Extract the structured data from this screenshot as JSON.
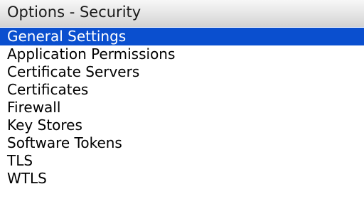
{
  "header": {
    "title": "Options - Security"
  },
  "menu": {
    "selected_index": 0,
    "items": [
      {
        "label": "General Settings"
      },
      {
        "label": "Application Permissions"
      },
      {
        "label": "Certificate Servers"
      },
      {
        "label": "Certificates"
      },
      {
        "label": "Firewall"
      },
      {
        "label": "Key Stores"
      },
      {
        "label": "Software Tokens"
      },
      {
        "label": "TLS"
      },
      {
        "label": "WTLS"
      }
    ]
  },
  "colors": {
    "selection": "#0a4fcf",
    "selected_text": "#ffffff",
    "text": "#000000"
  }
}
